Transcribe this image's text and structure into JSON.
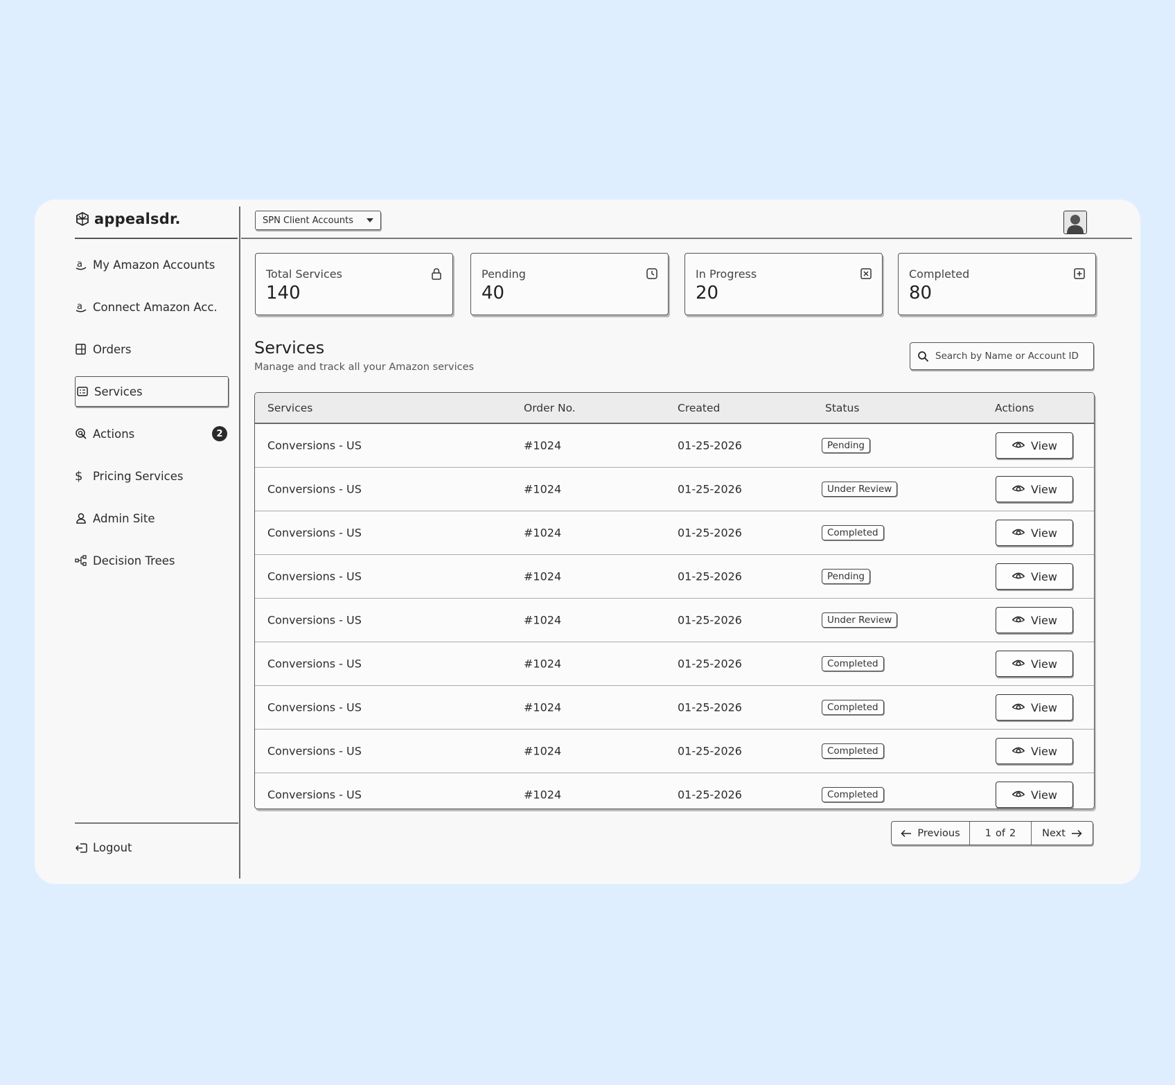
{
  "brand": {
    "name": "appealsdr."
  },
  "account_select": {
    "value": "SPN Client Accounts"
  },
  "sidebar": {
    "items": [
      {
        "label": "My Amazon Accounts",
        "icon": "amazon-icon"
      },
      {
        "label": "Connect Amazon Acc.",
        "icon": "amazon-icon"
      },
      {
        "label": "Orders",
        "icon": "orders-icon"
      },
      {
        "label": "Services",
        "icon": "services-icon",
        "active": true
      },
      {
        "label": "Actions",
        "icon": "actions-icon",
        "badge": "2"
      },
      {
        "label": "Pricing Services",
        "icon": "dollar-icon"
      },
      {
        "label": "Admin Site",
        "icon": "user-icon"
      },
      {
        "label": "Decision Trees",
        "icon": "tree-icon"
      }
    ],
    "logout": "Logout"
  },
  "stats": [
    {
      "label": "Total Services",
      "value": "140",
      "icon": "lock-icon"
    },
    {
      "label": "Pending",
      "value": "40",
      "icon": "clock-icon"
    },
    {
      "label": "In Progress",
      "value": "20",
      "icon": "close-box-icon"
    },
    {
      "label": "Completed",
      "value": "80",
      "icon": "plus-box-icon"
    }
  ],
  "section": {
    "title": "Services",
    "subtitle": "Manage and track all your Amazon services",
    "search_placeholder": "Search by Name or Account ID"
  },
  "table": {
    "headers": [
      "Services",
      "Order No.",
      "Created",
      "Status",
      "Actions"
    ],
    "rows": [
      {
        "service": "Conversions - US",
        "order": "#1024",
        "created": "01-25-2026",
        "status": "Pending",
        "action": "View"
      },
      {
        "service": "Conversions - US",
        "order": "#1024",
        "created": "01-25-2026",
        "status": "Under Review",
        "action": "View"
      },
      {
        "service": "Conversions - US",
        "order": "#1024",
        "created": "01-25-2026",
        "status": "Completed",
        "action": "View"
      },
      {
        "service": "Conversions - US",
        "order": "#1024",
        "created": "01-25-2026",
        "status": "Pending",
        "action": "View"
      },
      {
        "service": "Conversions - US",
        "order": "#1024",
        "created": "01-25-2026",
        "status": "Under Review",
        "action": "View"
      },
      {
        "service": "Conversions - US",
        "order": "#1024",
        "created": "01-25-2026",
        "status": "Completed",
        "action": "View"
      },
      {
        "service": "Conversions - US",
        "order": "#1024",
        "created": "01-25-2026",
        "status": "Completed",
        "action": "View"
      },
      {
        "service": "Conversions - US",
        "order": "#1024",
        "created": "01-25-2026",
        "status": "Completed",
        "action": "View"
      },
      {
        "service": "Conversions - US",
        "order": "#1024",
        "created": "01-25-2026",
        "status": "Completed",
        "action": "View"
      }
    ]
  },
  "pagination": {
    "previous": "Previous",
    "current": "1",
    "of": "of",
    "total": "2",
    "next": "Next"
  },
  "colors": {
    "background": "#dfeeff",
    "panel": "#f8f8f8",
    "ink": "#2b2b2b"
  }
}
